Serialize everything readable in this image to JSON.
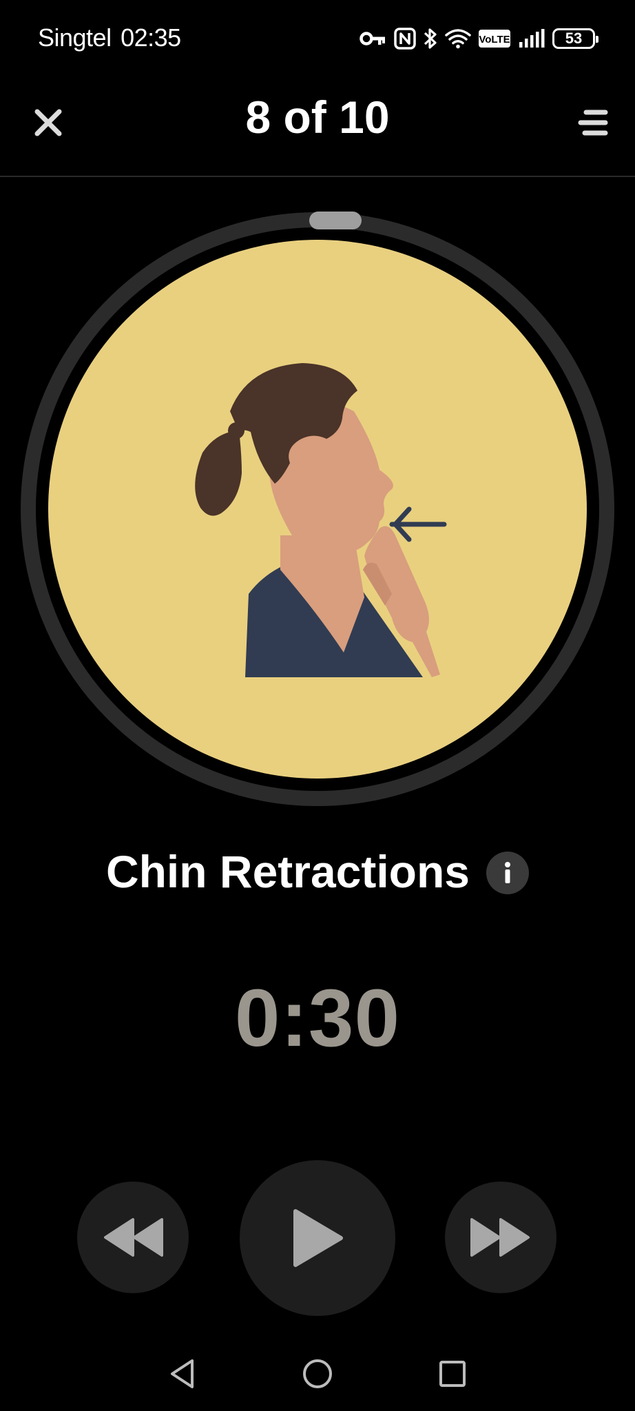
{
  "status_bar": {
    "carrier": "Singtel",
    "time": "02:35",
    "volte_label": "VoLTE",
    "battery_level": "53"
  },
  "header": {
    "progress_text": "8 of 10",
    "close_icon": "close-icon",
    "menu_icon": "menu-icon"
  },
  "exercise": {
    "title": "Chin Retractions",
    "info_icon": "info-icon",
    "illustration": "woman-chin-retraction-illustration"
  },
  "timer": {
    "display": "0:30"
  },
  "controls": {
    "rewind_icon": "rewind-icon",
    "play_icon": "play-icon",
    "forward_icon": "fast-forward-icon"
  },
  "nav_bar": {
    "back_icon": "nav-back-icon",
    "home_icon": "nav-home-icon",
    "recents_icon": "nav-recents-icon"
  },
  "colors": {
    "background": "#000000",
    "illustration_bg": "#e9d07f",
    "ring": "#2b2b2b",
    "ring_handle": "#9e9e9e",
    "timer": "#9a968d",
    "control_bg": "#1e1e1e",
    "control_icon": "#a8a8a8",
    "hair": "#4a3328",
    "skin": "#d89e7e",
    "shirt": "#313c52"
  }
}
